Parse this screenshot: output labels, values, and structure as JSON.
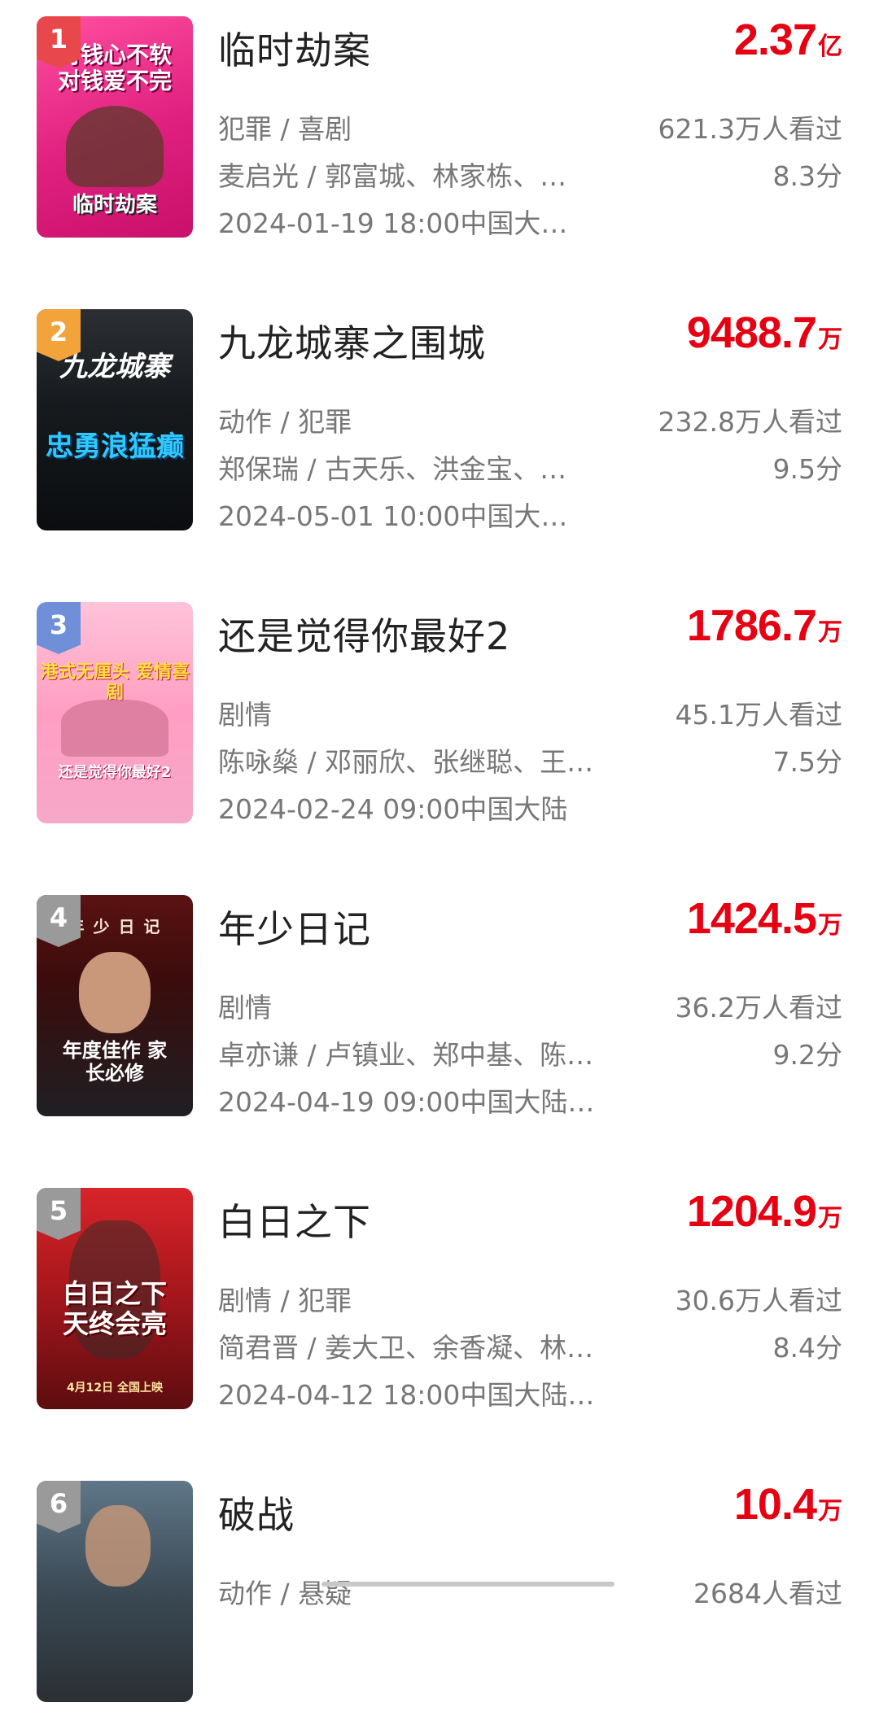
{
  "colors": {
    "accent_red": "#e60012",
    "rank_1": "#e8484b",
    "rank_2": "#f2a33a",
    "rank_3": "#6f8fd8",
    "rank_other": "#9a9a9a"
  },
  "movies": [
    {
      "rank": "1",
      "title": "临时劫案",
      "box_value": "2.37",
      "box_unit": "亿",
      "genres": "犯罪 / 喜剧",
      "cast": "麦启光 / 郭富城、林家栋、…",
      "release": "2024-01-19 18:00中国大…",
      "viewers": "621.3万人看过",
      "score": "8.3分",
      "poster_caption": "对钱心不软 对钱爱不完",
      "poster_subcaption": "临时劫案"
    },
    {
      "rank": "2",
      "title": "九龙城寨之围城",
      "box_value": "9488.7",
      "box_unit": "万",
      "genres": "动作 / 犯罪",
      "cast": "郑保瑞 / 古天乐、洪金宝、…",
      "release": "2024-05-01 10:00中国大…",
      "viewers": "232.8万人看过",
      "score": "9.5分",
      "poster_caption": "九龙城寨",
      "poster_subcaption": "忠勇浪猛癫"
    },
    {
      "rank": "3",
      "title": "还是觉得你最好2",
      "box_value": "1786.7",
      "box_unit": "万",
      "genres": "剧情",
      "cast": "陈咏燊 / 邓丽欣、张继聪、王…",
      "release": "2024-02-24 09:00中国大陆",
      "viewers": "45.1万人看过",
      "score": "7.5分",
      "poster_caption": "港式无厘头 爱情喜剧",
      "poster_subcaption": "还是觉得你最好2"
    },
    {
      "rank": "4",
      "title": "年少日记",
      "box_value": "1424.5",
      "box_unit": "万",
      "genres": "剧情",
      "cast": "卓亦谦 / 卢镇业、郑中基、陈…",
      "release": "2024-04-19 09:00中国大陆…",
      "viewers": "36.2万人看过",
      "score": "9.2分",
      "poster_caption": "年 少 日 记",
      "poster_subcaption": "年度佳作 家长必修"
    },
    {
      "rank": "5",
      "title": "白日之下",
      "box_value": "1204.9",
      "box_unit": "万",
      "genres": "剧情 / 犯罪",
      "cast": "简君晋 / 姜大卫、余香凝、林…",
      "release": "2024-04-12 18:00中国大陆…",
      "viewers": "30.6万人看过",
      "score": "8.4分",
      "poster_caption": "白日之下 天终会亮",
      "poster_subcaption": "4月12日 全国上映"
    },
    {
      "rank": "6",
      "title": "破战",
      "box_value": "10.4",
      "box_unit": "万",
      "genres": "动作 / 悬疑",
      "cast": "",
      "release": "",
      "viewers": "2684人看过",
      "score": "",
      "poster_caption": "",
      "poster_subcaption": ""
    }
  ]
}
